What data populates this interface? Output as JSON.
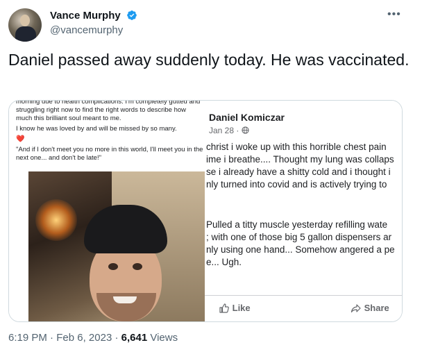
{
  "author": {
    "display_name": "Vance Murphy",
    "handle": "@vancemurphy"
  },
  "tweet": {
    "text": "Daniel passed away suddenly today. He was vaccinated.",
    "time": "6:19 PM",
    "date": "Feb 6, 2023",
    "separator": "·",
    "views_count": "6,641",
    "views_label": "Views"
  },
  "left_screenshot": {
    "paragraph_1": "morning due to health complications. I'm completely gutted and struggling right now to find the right words to describe how much this brilliant soul meant to me.",
    "paragraph_2": "I know he was loved by and will be missed by so many.",
    "heart": "❤️",
    "quote": "\"And if I don't meet you no more in this world, I'll meet you in the next one... and don't be late!\""
  },
  "right_screenshot": {
    "name": "Daniel Komiczar",
    "date": "Jan 28 ·",
    "post_1_lines": [
      "christ i woke up with this horrible chest pain",
      "ime i breathe.... Thought my lung was collaps",
      "se i already have a shitty cold and i thought i",
      "nly turned into covid and is actively trying to"
    ],
    "post_2_lines": [
      "Pulled a titty muscle yesterday refilling wate",
      "; with one of those big 5 gallon dispensers ar",
      "nly using one hand... Somehow angered a pe",
      "e... Ugh."
    ],
    "like_label": "Like",
    "share_label": "Share"
  },
  "icons": {
    "verified": "verified-badge-icon",
    "more": "more-options-icon",
    "globe": "globe-icon",
    "like": "thumbs-up-icon",
    "share": "share-arrow-icon"
  },
  "colors": {
    "verified_blue": "#1d9bf0",
    "secondary_text": "#536471",
    "fb_secondary": "#65676b"
  }
}
